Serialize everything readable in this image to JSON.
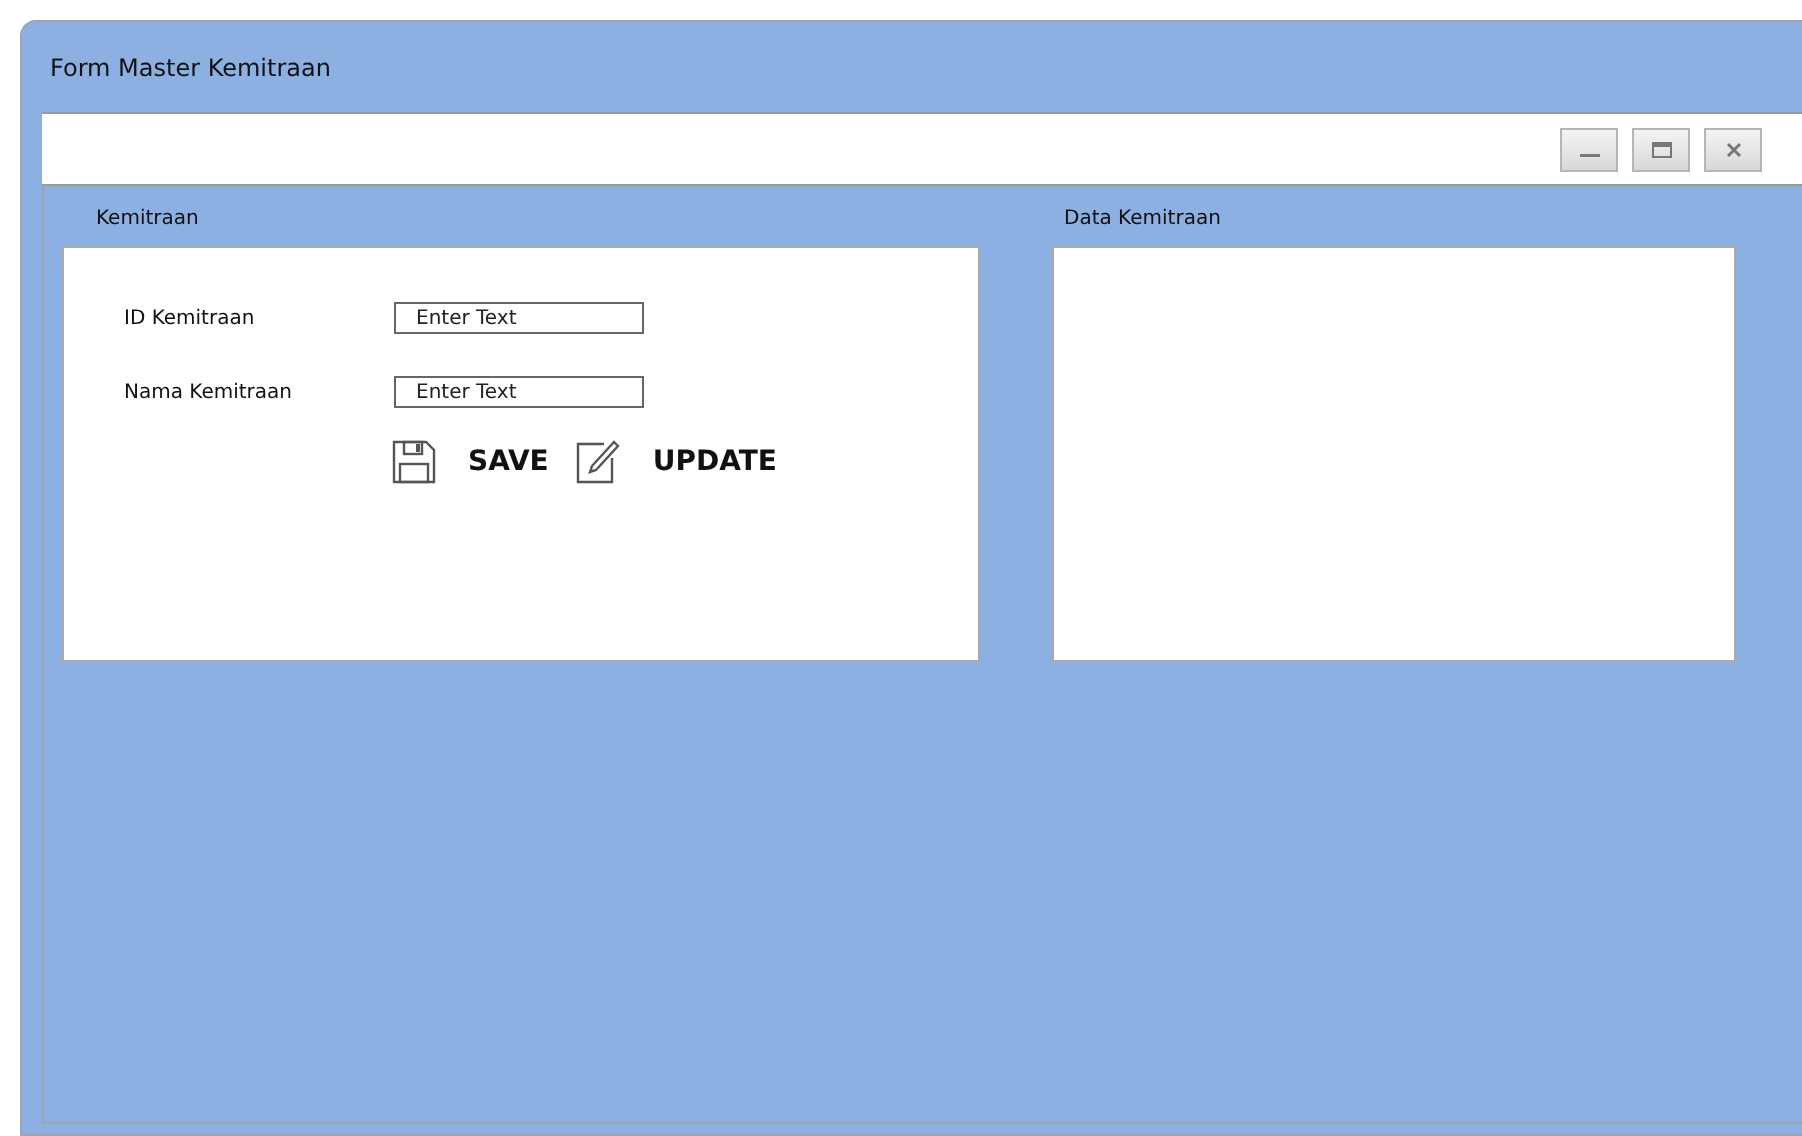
{
  "window": {
    "title": "Form Master Kemitraan"
  },
  "form_panel": {
    "title": "Kemitraan",
    "fields": [
      {
        "label": "ID Kemitraan",
        "placeholder": "Enter Text"
      },
      {
        "label": "Nama Kemitraan",
        "placeholder": "Enter Text"
      }
    ],
    "actions": [
      {
        "kind": "save",
        "label": "SAVE"
      },
      {
        "kind": "update",
        "label": "UPDATE"
      }
    ]
  },
  "data_panel": {
    "title": "Data Kemitraan"
  }
}
